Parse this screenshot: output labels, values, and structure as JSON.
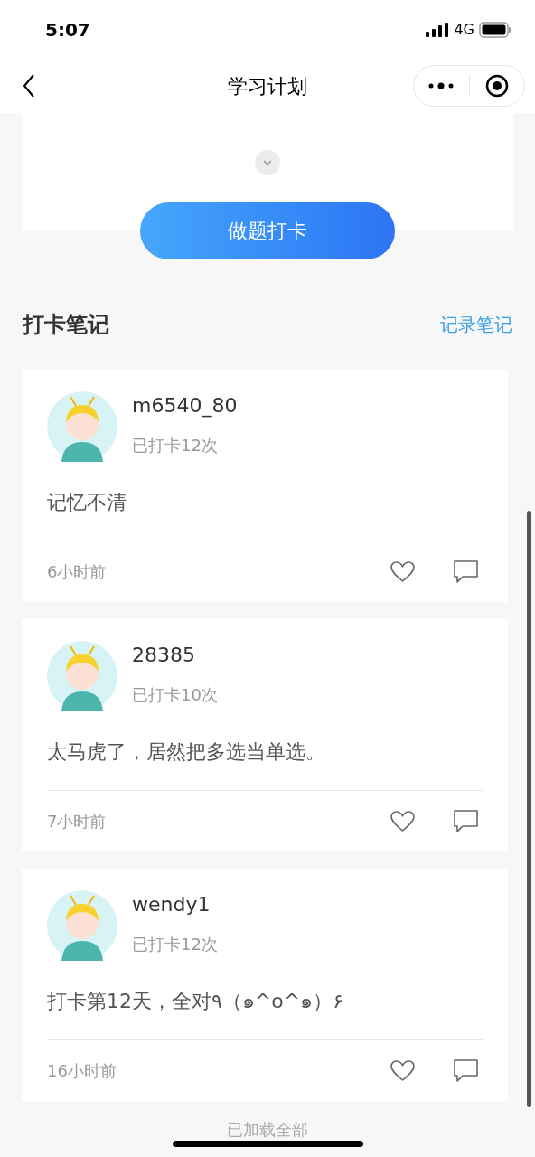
{
  "status_bar": {
    "time": "5:07",
    "network": "4G"
  },
  "nav": {
    "title": "学习计划"
  },
  "action_button": {
    "label": "做题打卡"
  },
  "section": {
    "title": "打卡笔记",
    "link": "记录笔记"
  },
  "notes": [
    {
      "user": "m6540_80",
      "count": "已打卡12次",
      "content": "记忆不清",
      "time": "6小时前"
    },
    {
      "user": "28385",
      "count": "已打卡10次",
      "content": "太马虎了，居然把多选当单选。",
      "time": "7小时前"
    },
    {
      "user": "wendy1",
      "count": "已打卡12次",
      "content": "打卡第12天，全对٩（๑^o^๑）۶",
      "time": "16小时前"
    }
  ],
  "footer": "已加载全部"
}
